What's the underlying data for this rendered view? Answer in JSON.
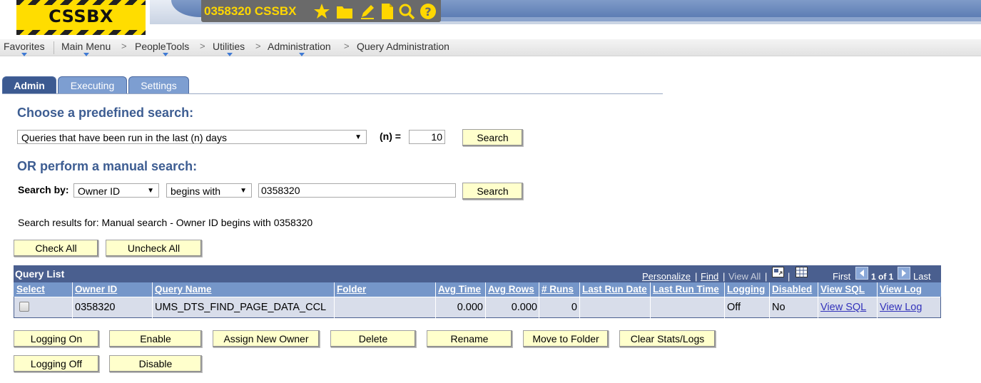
{
  "header": {
    "logo_text": "CSSBX",
    "env_label": "0358320 CSSBX",
    "icons": [
      "star-icon",
      "folder-icon",
      "pencil-icon",
      "document-icon",
      "search-icon",
      "help-icon"
    ],
    "colors": {
      "logo_yellow": "#ffdd00",
      "env_text": "#ffd700",
      "env_bg": "#6a6a6a"
    }
  },
  "breadcrumb": {
    "favorites": "Favorites",
    "main_menu": "Main Menu",
    "peopletools": "PeopleTools",
    "utilities": "Utilities",
    "administration": "Administration",
    "query_administration": "Query Administration",
    "separator": ">"
  },
  "tabs": [
    {
      "label": "Admin",
      "active": true
    },
    {
      "label": "Executing",
      "active": false
    },
    {
      "label": "Settings",
      "active": false
    }
  ],
  "predefined": {
    "heading": "Choose a predefined search:",
    "selected": "Queries that have been run in the last (n) days",
    "n_label": "(n) =",
    "n_value": "10",
    "search_label": "Search"
  },
  "manual": {
    "heading": "OR perform a manual search:",
    "search_by_label": "Search by:",
    "field_selected": "Owner ID",
    "operator_selected": "begins with",
    "value": "0358320",
    "search_label": "Search"
  },
  "results_text": "Search results for: Manual search - Owner ID begins with 0358320",
  "check_all": "Check All",
  "uncheck_all": "Uncheck All",
  "grid": {
    "title": "Query List",
    "personalize": "Personalize",
    "find": "Find",
    "view_all": "View All",
    "sep": "|",
    "first": "First",
    "count": "1 of 1",
    "last": "Last",
    "columns": [
      "Select",
      "Owner ID",
      "Query Name",
      "Folder",
      "Avg Time",
      "Avg Rows",
      "# Runs",
      "Last Run Date",
      "Last Run Time",
      "Logging",
      "Disabled",
      "View SQL",
      "View Log"
    ],
    "rows": [
      {
        "select": false,
        "owner_id": "0358320",
        "query_name": "UMS_DTS_FIND_PAGE_DATA_CCL",
        "folder": "",
        "avg_time": "0.000",
        "avg_rows": "0.000",
        "runs": "0",
        "last_run_date": "",
        "last_run_time": "",
        "logging": "Off",
        "disabled": "No",
        "view_sql": "View SQL",
        "view_log": "View Log"
      }
    ],
    "colors": {
      "header_bg": "#4a5f8f",
      "col_bg": "#7596c9",
      "row_bg": "#d8ddea"
    }
  },
  "actions": {
    "logging_on": "Logging On",
    "enable": "Enable",
    "assign_new_owner": "Assign New Owner",
    "delete": "Delete",
    "rename": "Rename",
    "move_to_folder": "Move to Folder",
    "clear_stats": "Clear Stats/Logs",
    "logging_off": "Logging Off",
    "disable": "Disable"
  },
  "colors": {
    "button_bg": "#ffffcc",
    "heading": "#3d5d92",
    "link": "#3333bb"
  }
}
